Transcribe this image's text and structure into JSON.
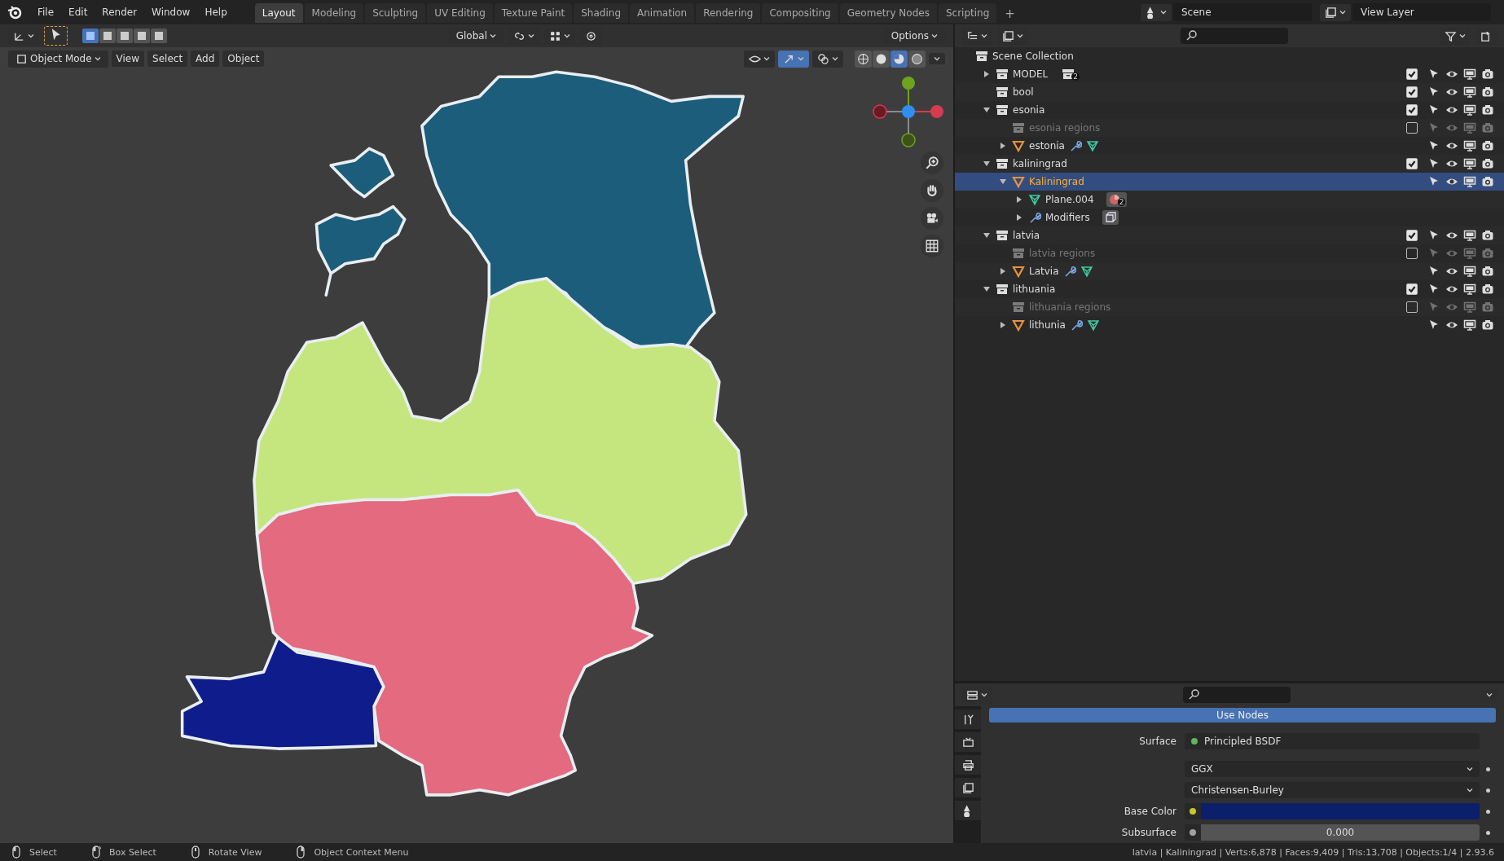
{
  "menu": [
    "File",
    "Edit",
    "Render",
    "Window",
    "Help"
  ],
  "workspaces": [
    {
      "label": "Layout",
      "selected": true
    },
    {
      "label": "Modeling",
      "selected": false
    },
    {
      "label": "Sculpting",
      "selected": false
    },
    {
      "label": "UV Editing",
      "selected": false
    },
    {
      "label": "Texture Paint",
      "selected": false
    },
    {
      "label": "Shading",
      "selected": false
    },
    {
      "label": "Animation",
      "selected": false
    },
    {
      "label": "Rendering",
      "selected": false
    },
    {
      "label": "Compositing",
      "selected": false
    },
    {
      "label": "Geometry Nodes",
      "selected": false
    },
    {
      "label": "Scripting",
      "selected": false
    }
  ],
  "add_workspace": "+",
  "scene": {
    "name": "Scene"
  },
  "view_layer": {
    "name": "View Layer"
  },
  "tool_header": {
    "select_modes": [
      {
        "selected": true
      },
      {
        "selected": false
      },
      {
        "selected": false
      },
      {
        "selected": false
      },
      {
        "selected": false
      }
    ],
    "orientation": "Global",
    "options": "Options"
  },
  "viewport_header": {
    "mode": "Object Mode",
    "menus": [
      "View",
      "Select",
      "Add",
      "Object"
    ],
    "shading_modes": [
      {
        "kind": "wireframe",
        "selected": false
      },
      {
        "kind": "solid",
        "selected": false
      },
      {
        "kind": "material",
        "selected": true
      },
      {
        "kind": "rendered",
        "selected": false
      }
    ]
  },
  "outliner": {
    "root": "Scene Collection",
    "items": [
      {
        "name": "MODEL",
        "kind": "collection",
        "expanded": false,
        "checked": true,
        "excluded": false,
        "selected": false,
        "badges": [
          {
            "kind": "collection",
            "count": "2"
          }
        ]
      },
      {
        "name": "bool",
        "kind": "collection",
        "checked": true,
        "excluded": false,
        "selected": false
      },
      {
        "name": "esonia",
        "kind": "collection",
        "expanded": true,
        "checked": true,
        "excluded": false,
        "selected": false,
        "children": [
          {
            "name": "esonia regions",
            "kind": "collection",
            "checked": false,
            "excluded": true,
            "selected": false
          },
          {
            "name": "estonia",
            "kind": "object",
            "expanded": false,
            "selected": false,
            "badges": [
              {
                "kind": "modifier"
              },
              {
                "kind": "mesh"
              }
            ]
          }
        ]
      },
      {
        "name": "kaliningrad",
        "kind": "collection",
        "expanded": true,
        "checked": true,
        "excluded": false,
        "selected": false,
        "children": [
          {
            "name": "Kaliningrad",
            "kind": "object",
            "expanded": true,
            "selected": true,
            "children": [
              {
                "name": "Plane.004",
                "kind": "mesh",
                "expanded": false,
                "selected": false,
                "badges": [
                  {
                    "kind": "material",
                    "count": "2"
                  }
                ]
              },
              {
                "name": "Modifiers",
                "kind": "modifier",
                "expanded": false,
                "selected": false,
                "badges": [
                  {
                    "kind": "solidify"
                  }
                ]
              }
            ]
          }
        ]
      },
      {
        "name": "latvia",
        "kind": "collection",
        "expanded": true,
        "checked": true,
        "excluded": false,
        "selected": false,
        "children": [
          {
            "name": "latvia regions",
            "kind": "collection",
            "checked": false,
            "excluded": true,
            "selected": false
          },
          {
            "name": "Latvia",
            "kind": "object",
            "expanded": false,
            "selected": false,
            "badges": [
              {
                "kind": "modifier"
              },
              {
                "kind": "mesh"
              }
            ]
          }
        ]
      },
      {
        "name": "lithuania",
        "kind": "collection",
        "expanded": true,
        "checked": true,
        "excluded": false,
        "selected": false,
        "children": [
          {
            "name": "lithuania regions",
            "kind": "collection",
            "checked": false,
            "excluded": true,
            "selected": false
          },
          {
            "name": "lithunia",
            "kind": "object",
            "expanded": false,
            "selected": false,
            "badges": [
              {
                "kind": "modifier"
              },
              {
                "kind": "mesh"
              }
            ]
          }
        ]
      }
    ]
  },
  "properties": {
    "use_nodes": "Use Nodes",
    "fields": [
      {
        "kind": "socket",
        "label": "Surface",
        "value": "Principled BSDF",
        "color": "#5cb85c"
      },
      {
        "kind": "dropdown",
        "value": "GGX"
      },
      {
        "kind": "dropdown",
        "value": "Christensen-Burley"
      },
      {
        "kind": "color",
        "label": "Base Color",
        "color": "#c7c72a",
        "swatch": {
          "color": "#0b1f6b"
        }
      },
      {
        "kind": "slider",
        "label": "Subsurface",
        "value": "0.000",
        "color": "#a1a1a1",
        "level": 0
      }
    ]
  },
  "status_bar": {
    "hints": [
      {
        "kind": "left-click",
        "label": "Select"
      },
      {
        "kind": "left-drag",
        "label": "Box Select"
      },
      {
        "kind": "middle",
        "label": "Rotate View"
      },
      {
        "kind": "right-click",
        "label": "Object Context Menu"
      }
    ],
    "stats": "latvia | Kaliningrad | Verts:6,878 | Faces:9,409 | Tris:13,708 | Objects:1/4 | 2.93.6"
  }
}
